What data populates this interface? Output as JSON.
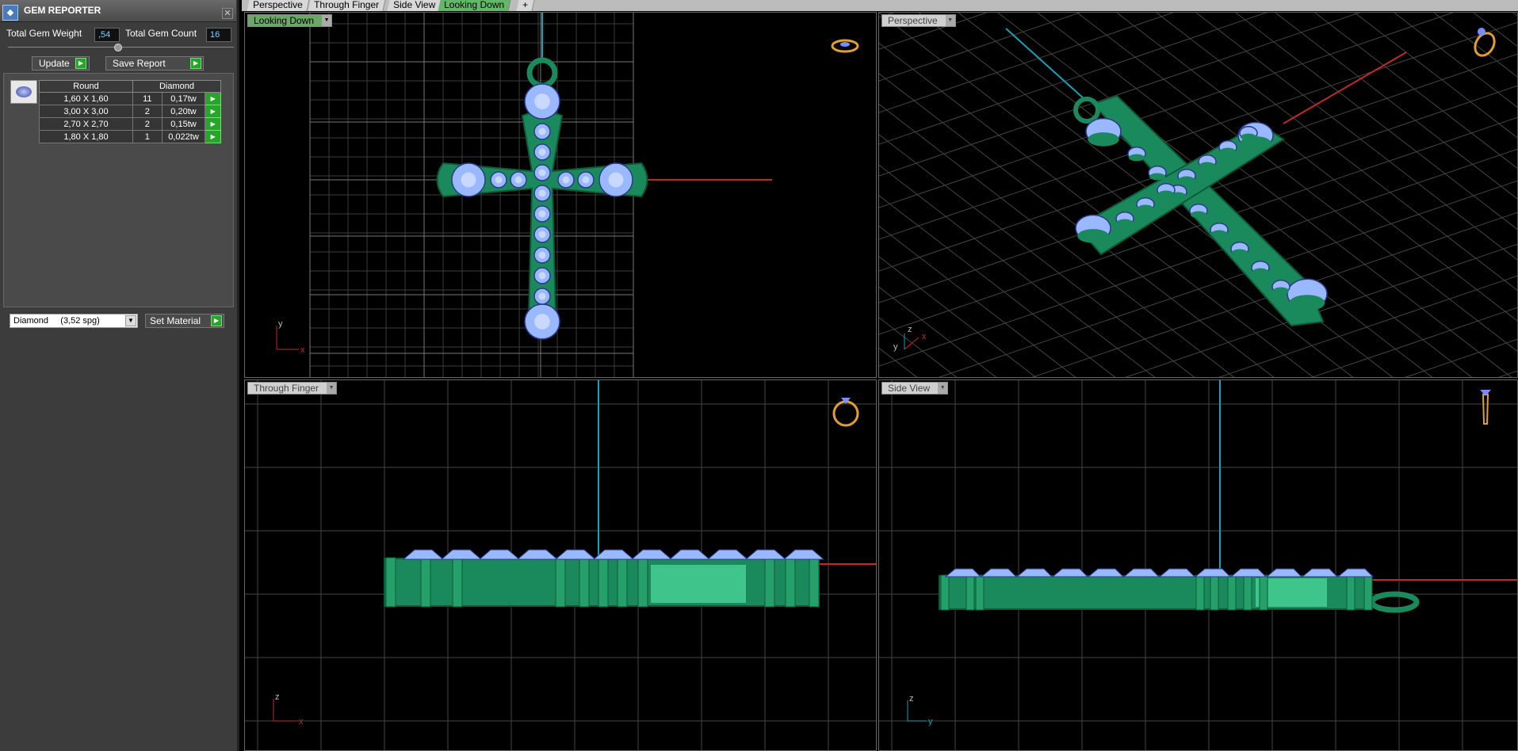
{
  "panel": {
    "title": "GEM REPORTER",
    "total_weight_label": "Total Gem Weight",
    "total_weight_value": ",54",
    "total_count_label": "Total Gem Count",
    "total_count_value": "16",
    "update_label": "Update",
    "save_report_label": "Save Report",
    "table_headers": [
      "Round",
      "Diamond"
    ],
    "rows": [
      {
        "size": "1,60 X 1,60",
        "count": "11",
        "weight": "0,17tw"
      },
      {
        "size": "3,00 X 3,00",
        "count": "2",
        "weight": "0,20tw"
      },
      {
        "size": "2,70 X 2,70",
        "count": "2",
        "weight": "0,15tw"
      },
      {
        "size": "1,80 X 1,80",
        "count": "1",
        "weight": "0,022tw"
      }
    ],
    "material_value": "Diamond     (3,52 spg)",
    "set_material_label": "Set Material"
  },
  "tabs": [
    "Perspective",
    "Through Finger",
    "Side View",
    "Looking Down",
    "+"
  ],
  "active_tab": "Looking Down",
  "viewports": {
    "top_left": {
      "label": "Looking Down",
      "axis1": "y",
      "axis2": "x"
    },
    "top_right": {
      "label": "Perspective",
      "axis1": "y",
      "axis2": "z",
      "axis3": "x"
    },
    "bottom_left": {
      "label": "Through Finger",
      "axis1": "z",
      "axis2": "x"
    },
    "bottom_right": {
      "label": "Side View",
      "axis1": "z",
      "axis2": "y"
    }
  },
  "colors": {
    "metal": "#1a8a5c",
    "gem": "#9ab8ff",
    "grid": "#5a5a5a",
    "axis_red": "#c0282a",
    "axis_cyan": "#1aa0b5",
    "panel_bg": "#3c3c3c"
  }
}
